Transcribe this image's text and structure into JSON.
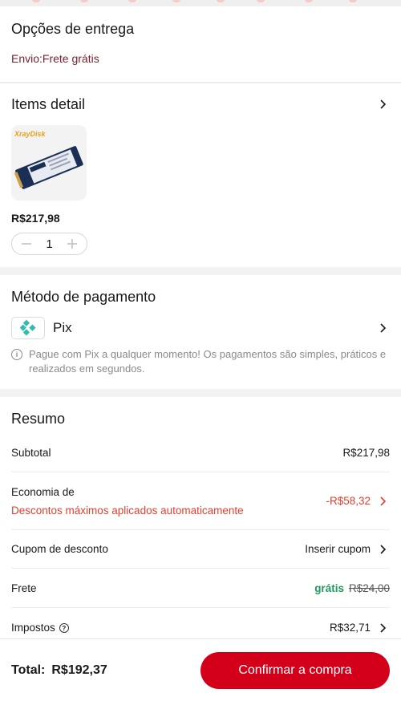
{
  "delivery": {
    "title": "Opções de entrega",
    "shipping": "Envio:Frete grátis"
  },
  "items": {
    "title": "Items detail",
    "product_brand": "XrayDisk",
    "price": "R$217,98",
    "quantity": "1"
  },
  "payment": {
    "title": "Método de pagamento",
    "method": "Pix",
    "note": "Pague com Pix a qualquer momento! Os pagamentos são simples, práticos e realizados em segundos."
  },
  "summary": {
    "title": "Resumo",
    "subtotal_label": "Subtotal",
    "subtotal_value": "R$217,98",
    "economy_label": "Economia de",
    "economy_sub": "Descontos máximos aplicados automaticamente",
    "economy_value": "-R$58,32",
    "coupon_label": "Cupom de desconto",
    "coupon_value": "Inserir cupom",
    "freight_label": "Frete",
    "freight_free": "grátis",
    "freight_old": "R$24,00",
    "tax_label": "Impostos",
    "tax_value": "R$32,71"
  },
  "footer": {
    "total_label": "Total:",
    "total_value": "R$192,37",
    "confirm_label": "Confirmar a compra"
  },
  "colors": {
    "accent_red": "#d4001a",
    "discount_red": "#e0412f",
    "free_green": "#1f9a5c",
    "pix_teal": "#32bcad"
  }
}
